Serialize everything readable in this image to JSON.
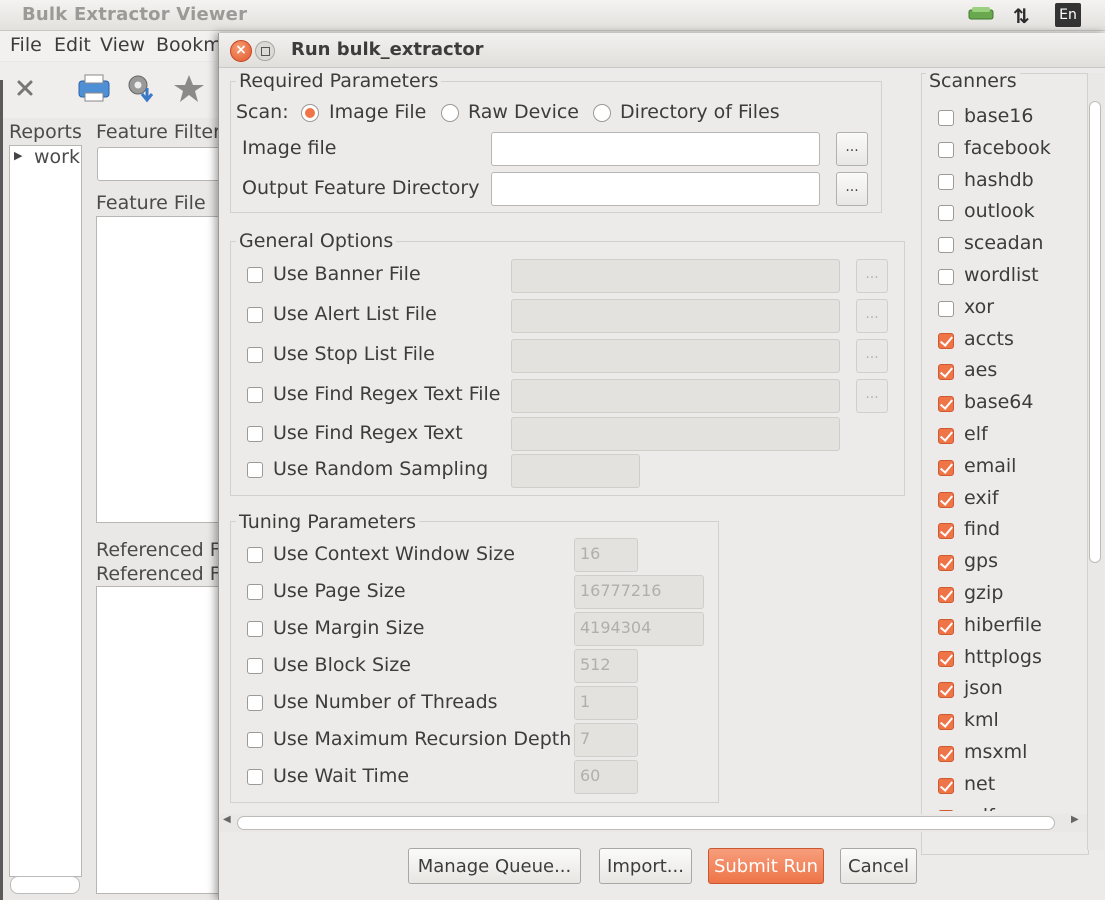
{
  "background_app": {
    "title": "Bulk Extractor Viewer",
    "menu": [
      "File",
      "Edit",
      "View",
      "Bookm"
    ],
    "reports_label": "Reports",
    "tree_item": "work",
    "feature_filter_label": "Feature Filter",
    "feature_file_label": "Feature File",
    "referenced_1": "Referenced F",
    "referenced_2": "Referenced F",
    "tray_lang": "En"
  },
  "dialog": {
    "title": "Run bulk_extractor",
    "required": {
      "legend": "Required Parameters",
      "scan_label": "Scan:",
      "scan_options": [
        "Image File",
        "Raw Device",
        "Directory of Files"
      ],
      "selected": "Image File",
      "image_file_label": "Image file",
      "image_file_value": "",
      "output_dir_label": "Output Feature Directory",
      "output_dir_value": "",
      "browse": "..."
    },
    "general": {
      "legend": "General Options",
      "options": [
        {
          "label": "Use Banner File",
          "checked": false
        },
        {
          "label": "Use Alert List File",
          "checked": false
        },
        {
          "label": "Use Stop List File",
          "checked": false
        },
        {
          "label": "Use Find Regex Text File",
          "checked": false
        },
        {
          "label": "Use Find Regex Text",
          "checked": false
        },
        {
          "label": "Use Random Sampling",
          "checked": false
        }
      ]
    },
    "tuning": {
      "legend": "Tuning Parameters",
      "options": [
        {
          "label": "Use Context Window Size",
          "value": "16"
        },
        {
          "label": "Use Page Size",
          "value": "16777216"
        },
        {
          "label": "Use Margin Size",
          "value": "4194304"
        },
        {
          "label": "Use Block Size",
          "value": "512"
        },
        {
          "label": "Use Number of Threads",
          "value": "1"
        },
        {
          "label": "Use Maximum Recursion Depth",
          "value": "7"
        },
        {
          "label": "Use Wait Time",
          "value": "60"
        }
      ]
    },
    "scanners": {
      "legend": "Scanners",
      "items": [
        {
          "name": "base16",
          "checked": false
        },
        {
          "name": "facebook",
          "checked": false
        },
        {
          "name": "hashdb",
          "checked": false
        },
        {
          "name": "outlook",
          "checked": false
        },
        {
          "name": "sceadan",
          "checked": false
        },
        {
          "name": "wordlist",
          "checked": false
        },
        {
          "name": "xor",
          "checked": false
        },
        {
          "name": "accts",
          "checked": true
        },
        {
          "name": "aes",
          "checked": true
        },
        {
          "name": "base64",
          "checked": true
        },
        {
          "name": "elf",
          "checked": true
        },
        {
          "name": "email",
          "checked": true
        },
        {
          "name": "exif",
          "checked": true
        },
        {
          "name": "find",
          "checked": true
        },
        {
          "name": "gps",
          "checked": true
        },
        {
          "name": "gzip",
          "checked": true
        },
        {
          "name": "hiberfile",
          "checked": true
        },
        {
          "name": "httplogs",
          "checked": true
        },
        {
          "name": "json",
          "checked": true
        },
        {
          "name": "kml",
          "checked": true
        },
        {
          "name": "msxml",
          "checked": true
        },
        {
          "name": "net",
          "checked": true
        },
        {
          "name": "pdf",
          "checked": true
        }
      ]
    },
    "buttons": {
      "manage_queue": "Manage Queue...",
      "import": "Import...",
      "submit": "Submit Run",
      "cancel": "Cancel"
    },
    "colors": {
      "accent": "#ef7447"
    }
  }
}
